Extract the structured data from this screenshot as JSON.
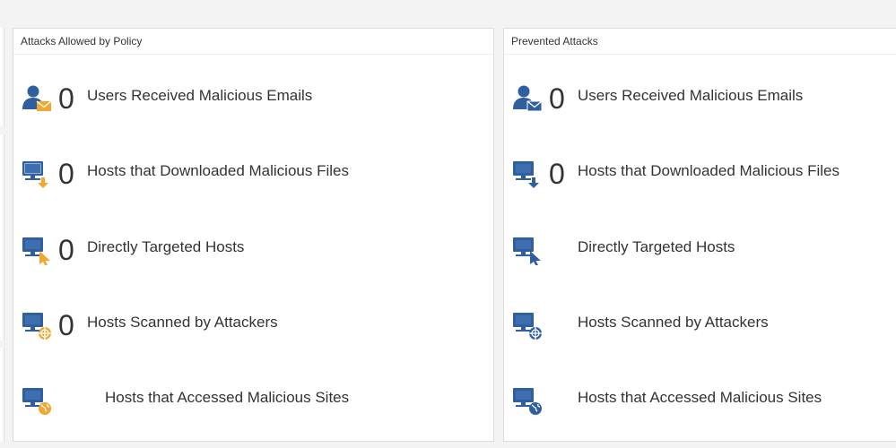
{
  "colors": {
    "icon_blue": "#2f5f9e",
    "icon_orange": "#f0a830",
    "panel_border": "#dcdcdc",
    "background": "#f3f3f3"
  },
  "panels": [
    {
      "title": "Attacks Allowed by Policy",
      "accent": "orange",
      "rows": [
        {
          "icon": "user-mail-icon",
          "count": "0",
          "label": "Users Received Malicious Emails"
        },
        {
          "icon": "host-download-icon",
          "count": "0",
          "label": "Hosts that Downloaded Malicious Files"
        },
        {
          "icon": "host-targeted-icon",
          "count": "0",
          "label": "Directly Targeted Hosts"
        },
        {
          "icon": "host-scanned-icon",
          "count": "0",
          "label": "Hosts Scanned by Attackers"
        },
        {
          "icon": "host-malicious-site-icon",
          "count": "",
          "label": "Hosts that Accessed Malicious Sites"
        }
      ]
    },
    {
      "title": "Prevented Attacks",
      "accent": "blue",
      "rows": [
        {
          "icon": "user-mail-icon",
          "count": "0",
          "label": "Users Received Malicious Emails"
        },
        {
          "icon": "host-download-icon",
          "count": "0",
          "label": "Hosts that Downloaded Malicious Files"
        },
        {
          "icon": "host-targeted-icon",
          "count": "",
          "label": "Directly Targeted Hosts"
        },
        {
          "icon": "host-scanned-icon",
          "count": "",
          "label": "Hosts Scanned by Attackers"
        },
        {
          "icon": "host-malicious-site-icon",
          "count": "",
          "label": "Hosts that Accessed Malicious Sites"
        }
      ]
    }
  ]
}
